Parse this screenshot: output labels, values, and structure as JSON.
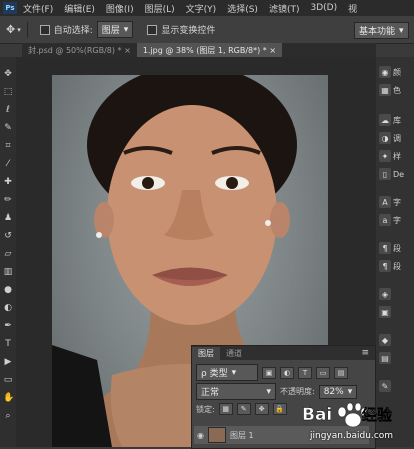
{
  "menu": {
    "logo": "Ps",
    "items": [
      "文件(F)",
      "编辑(E)",
      "图像(I)",
      "图层(L)",
      "文字(Y)",
      "选择(S)",
      "滤镜(T)",
      "3D(D)",
      "视"
    ]
  },
  "options": {
    "auto_select_label": "自动选择:",
    "auto_select_value": "图层",
    "transform_label": "显示变换控件",
    "workspace_value": "基本功能"
  },
  "tabs": [
    {
      "label": "封.psd @ 50%(RGB/8) *"
    },
    {
      "label": "1.jpg @ 38% (图层 1, RGB/8*) *"
    }
  ],
  "right_panel": {
    "items": [
      "颜",
      "色",
      "库",
      "调",
      "样",
      "De",
      "字",
      "字",
      "段",
      "段",
      "",
      ""
    ]
  },
  "layers_panel": {
    "tab_layers": "图层",
    "tab_channels": "通道",
    "filter_kind": "ρ 类型",
    "blend_mode": "正常",
    "opacity_label": "不透明度:",
    "opacity_value": "82%",
    "lock_label": "锁定:",
    "layer_name": "图层 1"
  },
  "watermark": {
    "brand": "Bai du 经验",
    "url": "jingyan.baidu.com"
  },
  "colors": {
    "menubar": "#2b2b2b",
    "panel": "#454545",
    "canvas_bg": "#2a2a2a"
  }
}
